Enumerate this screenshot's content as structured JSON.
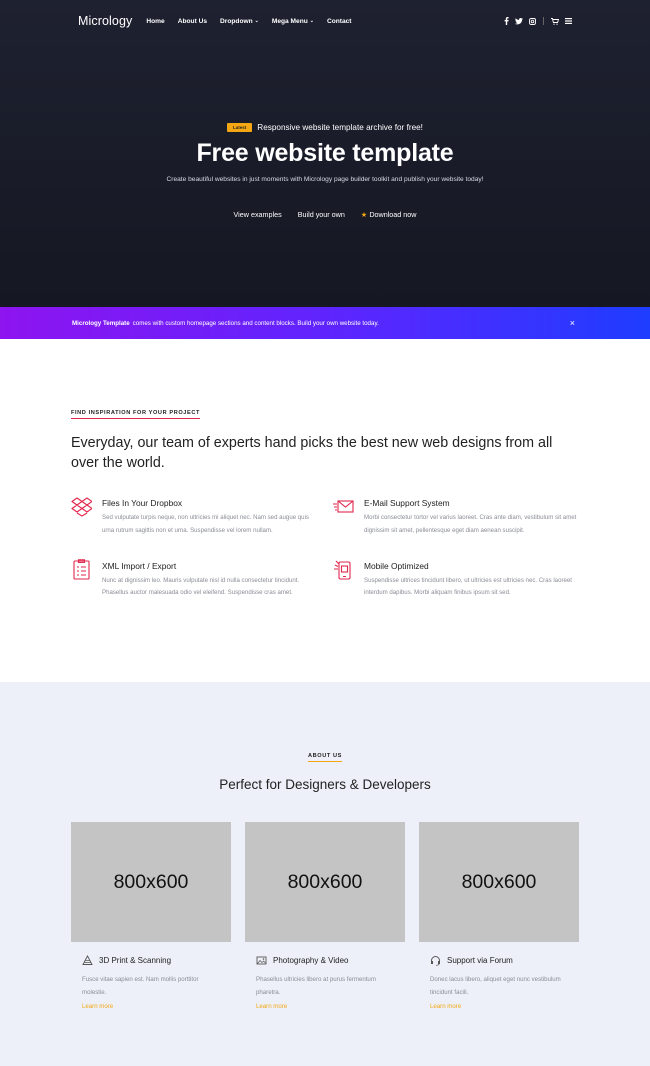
{
  "nav": {
    "brand": "Micrology",
    "items": [
      {
        "label": "Home",
        "caret": ""
      },
      {
        "label": "About Us",
        "caret": ""
      },
      {
        "label": "Dropdown",
        "caret": "⌄"
      },
      {
        "label": "Mega Menu",
        "caret": "⌄"
      },
      {
        "label": "Contact",
        "caret": ""
      }
    ],
    "social_icons": [
      "facebook-icon",
      "twitter-icon",
      "instagram-icon",
      "cart-icon",
      "menu-icon"
    ]
  },
  "hero": {
    "badge": "Latest",
    "tagline": "Responsive website template archive for free!",
    "title": "Free website template",
    "subtitle": "Create beautiful websites in just moments with Micrology page builder toolkit and publish your website today!",
    "links": [
      "View examples",
      "Build your own",
      "Download now"
    ]
  },
  "banner": {
    "bold": "Micrology Template",
    "text": "comes with custom homepage sections and content blocks. Build your own website today.",
    "close": "×"
  },
  "features": {
    "eyebrow": "FIND INSPIRATION FOR YOUR PROJECT",
    "lead": "Everyday, our team of experts hand picks the best new web designs from all over the world.",
    "items": [
      {
        "title": "Files In Your Dropbox",
        "desc": "Sed vulputate turpis neque, non ultricies mi aliquet nec. Nam sed augue quis urna rutrum sagittis non et urna. Suspendisse vel lorem nullam.",
        "icon": "dropbox-icon"
      },
      {
        "title": "E-Mail Support System",
        "desc": "Morbi consectetur tortor vel varius laoreet. Cras ante diam, vestibulum sit amet dignissim sit amet, pellentesque eget diam aenean suscipit.",
        "icon": "email-icon"
      },
      {
        "title": "XML Import / Export",
        "desc": "Nunc at dignissim leo. Mauris vulputate nisl id nulla consectetur tincidunt. Phasellus auctor malesuada odio vel eleifend. Suspendisse cras amet.",
        "icon": "document-icon"
      },
      {
        "title": "Mobile Optimized",
        "desc": "Suspendisse ultrices tincidunt libero, ut ultricies est ultricies nec. Cras laoreet interdum dapibus. Morbi aliquam finibus ipsum sit sed.",
        "icon": "mobile-icon"
      }
    ]
  },
  "about": {
    "eyebrow": "ABOUT US",
    "title": "Perfect for Designers & Developers",
    "cards": [
      {
        "image_label": "800x600",
        "title": "3D Print & Scanning",
        "desc": "Fusce vitae sapien est. Nam mollis porttitor molestie.",
        "link": "Learn more",
        "icon": "print-icon"
      },
      {
        "image_label": "800x600",
        "title": "Photography & Video",
        "desc": "Phasellus ultricies libero at purus fermentum pharetra.",
        "link": "Learn more",
        "icon": "image-icon"
      },
      {
        "image_label": "800x600",
        "title": "Support via Forum",
        "desc": "Donec lacus libero, aliquet eget nunc vestibulum tincidunt facili.",
        "link": "Learn more",
        "icon": "headset-icon"
      }
    ]
  },
  "colors": {
    "accent": "#e2264d",
    "gold": "#f3a712",
    "hero_bg": "#1b1d2a",
    "banner_start": "#8e14f0",
    "banner_end": "#1e3dff",
    "about_bg": "#edf0f8"
  }
}
